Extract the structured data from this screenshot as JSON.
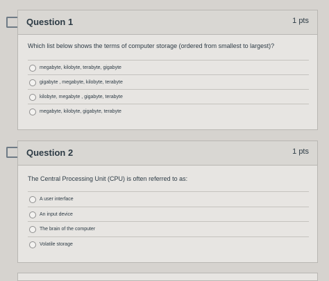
{
  "questions": [
    {
      "title": "Question 1",
      "points": "1 pts",
      "text": "Which list below shows the terms of computer storage (ordered from smallest to largest)?",
      "answers": [
        "megabyte, kilobyte, terabyte, gigabyte",
        "gigabyte , megabyte, kilobyte, terabyte",
        "kilobyte, megabyte , gigabyte, terabyte",
        "megabyte, kilobyte, gigabyte, terabyte"
      ]
    },
    {
      "title": "Question 2",
      "points": "1 pts",
      "text": "The Central Processing Unit (CPU) is often referred to as:",
      "answers": [
        "A user interface",
        "An input device",
        "The brain of the computer",
        "Volatile storage"
      ]
    }
  ]
}
